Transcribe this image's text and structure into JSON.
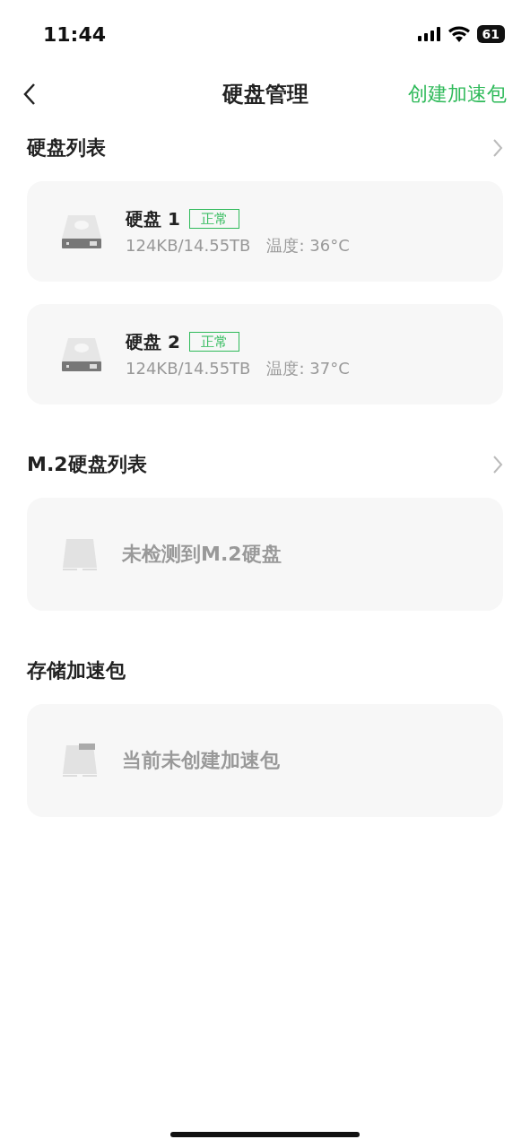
{
  "status_bar": {
    "time": "11:44",
    "battery": "61"
  },
  "nav": {
    "title": "硬盘管理",
    "action": "创建加速包"
  },
  "sections": [
    {
      "title": "硬盘列表",
      "has_arrow": true,
      "kind": "disks",
      "disks": [
        {
          "name": "硬盘 1",
          "status": "正常",
          "usage": "124KB/14.55TB",
          "temperature": "温度: 36°C"
        },
        {
          "name": "硬盘 2",
          "status": "正常",
          "usage": "124KB/14.55TB",
          "temperature": "温度: 37°C"
        }
      ]
    },
    {
      "title": "M.2硬盘列表",
      "has_arrow": true,
      "kind": "slot",
      "message": "未检测到M.2硬盘"
    },
    {
      "title": "存储加速包",
      "has_arrow": false,
      "kind": "pack",
      "message": "当前未创建加速包"
    }
  ]
}
